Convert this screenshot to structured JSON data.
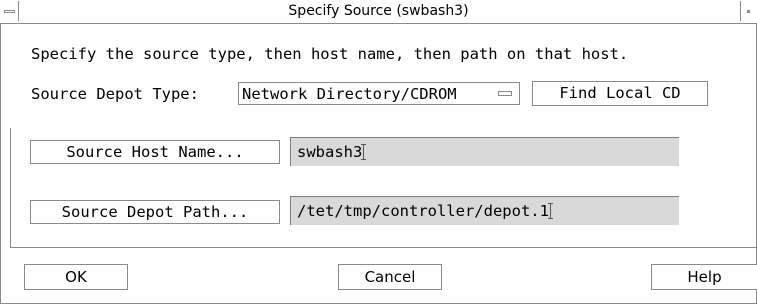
{
  "window": {
    "title": "Specify Source (swbash3)"
  },
  "instruction": "Specify the source type, then host name, then path on that host.",
  "depot_type": {
    "label": "Source Depot Type:",
    "selected": "Network Directory/CDROM"
  },
  "buttons": {
    "find_local_cd": "Find Local CD",
    "source_host_name": "Source Host Name...",
    "source_depot_path": "Source Depot Path...",
    "ok": "OK",
    "cancel": "Cancel",
    "help": "Help"
  },
  "fields": {
    "host_name": "swbash3",
    "depot_path": "/tet/tmp/controller/depot.1"
  },
  "colors": {
    "field_bg": "#d9d9d9",
    "border": "#8a8a8a"
  }
}
